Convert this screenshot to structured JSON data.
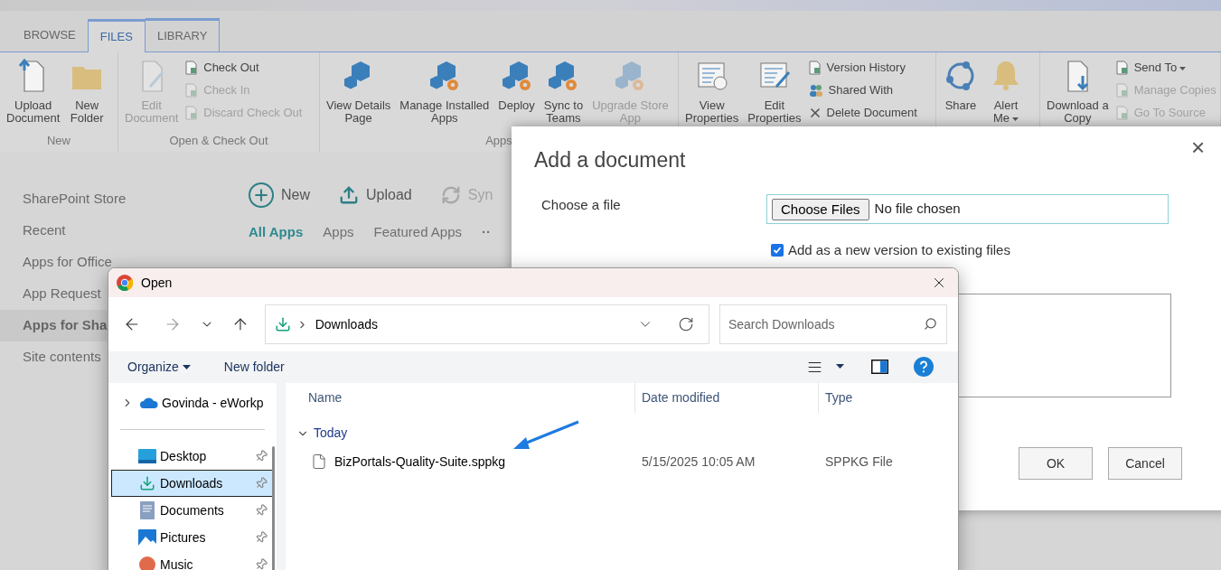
{
  "ribbon_tabs": [
    {
      "label": "BROWSE",
      "selected": false
    },
    {
      "label": "FILES",
      "selected": true
    },
    {
      "label": "LIBRARY",
      "selected": false
    }
  ],
  "ribbon_groups": [
    {
      "label": "New",
      "items": [
        {
          "kind": "large",
          "label": "Upload\nDocument",
          "disabled": false,
          "dropdown": false
        },
        {
          "kind": "large",
          "label": "New\nFolder",
          "disabled": false,
          "dropdown": false
        }
      ]
    },
    {
      "label": "Open & Check Out",
      "items": [
        {
          "kind": "large",
          "label": "Edit\nDocument",
          "disabled": true,
          "dropdown": false
        },
        {
          "kind": "small",
          "label": "Check Out",
          "disabled": false,
          "dropdown": false
        },
        {
          "kind": "small",
          "label": "Check In",
          "disabled": true,
          "dropdown": false
        },
        {
          "kind": "small",
          "label": "Discard Check Out",
          "disabled": true,
          "dropdown": false
        }
      ]
    },
    {
      "label": "Apps",
      "items": [
        {
          "kind": "large",
          "label": "View Details\nPage",
          "disabled": false,
          "dropdown": false
        },
        {
          "kind": "large",
          "label": "Manage Installed\nApps",
          "disabled": false,
          "dropdown": false
        },
        {
          "kind": "large",
          "label": "Deploy\n",
          "disabled": false,
          "dropdown": false
        },
        {
          "kind": "large",
          "label": "Sync to\nTeams",
          "disabled": false,
          "dropdown": false
        },
        {
          "kind": "large",
          "label": "Upgrade Store\nApp",
          "disabled": true,
          "dropdown": false
        }
      ]
    },
    {
      "items": [
        {
          "kind": "large",
          "label": "View\nProperties",
          "disabled": false,
          "dropdown": false
        },
        {
          "kind": "large",
          "label": "Edit\nProperties",
          "disabled": false,
          "dropdown": false
        },
        {
          "kind": "small",
          "label": "Version History",
          "disabled": false,
          "dropdown": false
        },
        {
          "kind": "small",
          "label": "Shared With",
          "disabled": false,
          "dropdown": false
        },
        {
          "kind": "small",
          "label": "Delete Document",
          "disabled": false,
          "dropdown": false
        }
      ]
    },
    {
      "items": [
        {
          "kind": "large",
          "label": "Share\n",
          "disabled": false,
          "dropdown": false
        },
        {
          "kind": "large",
          "label": "Alert\nMe",
          "disabled": false,
          "dropdown": true
        }
      ]
    },
    {
      "items": [
        {
          "kind": "large",
          "label": "Download a\nCopy",
          "disabled": false,
          "dropdown": false
        },
        {
          "kind": "small",
          "label": "Send To",
          "disabled": false,
          "dropdown": true
        },
        {
          "kind": "small",
          "label": "Manage Copies",
          "disabled": true,
          "dropdown": false
        },
        {
          "kind": "small",
          "label": "Go To Source",
          "disabled": true,
          "dropdown": false
        }
      ]
    }
  ],
  "left_nav": [
    {
      "label": "SharePoint Store",
      "selected": false
    },
    {
      "label": "Recent",
      "selected": false
    },
    {
      "label": "Apps for Office",
      "selected": false
    },
    {
      "label": "App Request",
      "selected": false
    },
    {
      "label": "Apps for Sha",
      "selected": true
    },
    {
      "label": "Site contents",
      "selected": false
    }
  ],
  "commands": [
    {
      "label": "New",
      "disabled": false
    },
    {
      "label": "Upload",
      "disabled": false
    },
    {
      "label": "Syn",
      "disabled": true
    }
  ],
  "views": [
    {
      "label": "All Apps",
      "selected": true
    },
    {
      "label": "Apps",
      "selected": false
    },
    {
      "label": "Featured Apps",
      "selected": false
    }
  ],
  "views_more": "··",
  "add_document_dialog": {
    "title": "Add a document",
    "close": "×",
    "file_label": "Choose a file",
    "choose_button": "Choose Files",
    "file_status": "No file chosen",
    "add_version": {
      "label": "Add as a new version to existing files",
      "checked": true
    },
    "buttons": [
      "OK",
      "Cancel"
    ]
  },
  "open_dialog": {
    "title": "Open",
    "path": "Downloads",
    "search": {
      "placeholder": "Search Downloads"
    },
    "organize": "Organize",
    "new_folder": "New folder",
    "nav": [
      {
        "label": "Govinda - eWorkp",
        "kind": "cloud",
        "selected": false
      },
      {
        "label": "Desktop",
        "kind": "desktop",
        "selected": false
      },
      {
        "label": "Downloads",
        "kind": "downloads",
        "selected": true
      },
      {
        "label": "Documents",
        "kind": "documents",
        "selected": false
      },
      {
        "label": "Pictures",
        "kind": "pictures",
        "selected": false
      },
      {
        "label": "Music",
        "kind": "music",
        "selected": false
      }
    ],
    "columns": [
      "Name",
      "Date modified",
      "Type"
    ],
    "group": "Today",
    "files": [
      {
        "name": "BizPortals-Quality-Suite.sppkg",
        "date": "5/15/2025 10:05 AM",
        "type": "SPPKG File"
      }
    ]
  }
}
